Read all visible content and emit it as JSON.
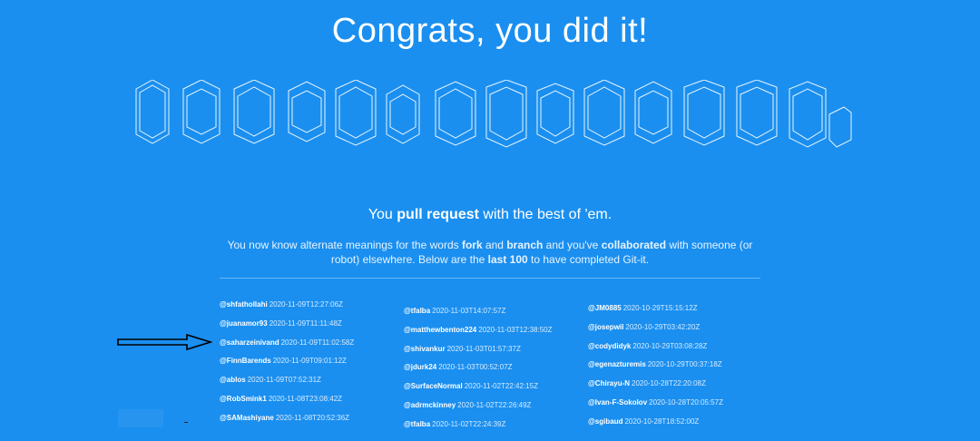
{
  "title": "Congrats, you did it!",
  "subtitle": {
    "part1": "You ",
    "strong1": "pull request",
    "part2": " with the best of 'em."
  },
  "intro": {
    "p1": "You now know alternate meanings for the words ",
    "b1": "fork",
    "p2": " and ",
    "b2": "branch",
    "p3": " and you've ",
    "b3": "collaborated",
    "p4": " with someone (or robot) elsewhere. Below are the ",
    "b4": "last 100",
    "p5": " to have completed Git-it."
  },
  "contributors": {
    "col1": [
      {
        "user": "@shfathollahi",
        "time": "2020-11-09T12:27:06Z"
      },
      {
        "user": "@juanamor93",
        "time": "2020-11-09T11:11:48Z"
      },
      {
        "user": "@saharzeinivand",
        "time": "2020-11-09T11:02:58Z"
      },
      {
        "user": "@FinnBarends",
        "time": "2020-11-09T09:01:12Z"
      },
      {
        "user": "@ablos",
        "time": "2020-11-09T07:52:31Z"
      },
      {
        "user": "@RobSmink1",
        "time": "2020-11-08T23:08:42Z"
      },
      {
        "user": "@SAMashiyane",
        "time": "2020-11-08T20:52:36Z"
      }
    ],
    "col2": [
      {
        "user": "@tfalba",
        "time": "2020-11-03T14:07:57Z"
      },
      {
        "user": "@matthewbenton224",
        "time": "2020-11-03T12:38:50Z"
      },
      {
        "user": "@shivankur",
        "time": "2020-11-03T01:57:37Z"
      },
      {
        "user": "@jdurk24",
        "time": "2020-11-03T00:52:07Z"
      },
      {
        "user": "@SurfaceNormal",
        "time": "2020-11-02T22:42:15Z"
      },
      {
        "user": "@adrmckinney",
        "time": "2020-11-02T22:26:49Z"
      },
      {
        "user": "@tfalba",
        "time": "2020-11-02T22:24:39Z"
      }
    ],
    "col3": [
      {
        "user": "@JM0885",
        "time": "2020-10-29T15:15:12Z"
      },
      {
        "user": "@josepwil",
        "time": "2020-10-29T03:42:20Z"
      },
      {
        "user": "@codydidyk",
        "time": "2020-10-29T03:08:28Z"
      },
      {
        "user": "@egenazturemis",
        "time": "2020-10-29T00:37:18Z"
      },
      {
        "user": "@Chirayu-N",
        "time": "2020-10-28T22:20:08Z"
      },
      {
        "user": "@Ivan-F-Sokolov",
        "time": "2020-10-28T20:05:57Z"
      },
      {
        "user": "@sgibaud",
        "time": "2020-10-28T18:52:00Z"
      }
    ]
  },
  "colors": {
    "background": "#1a8ff0",
    "text": "#ffffff",
    "banner_line": "#ffffff"
  },
  "icons": {
    "arrow": "arrow-right-icon"
  }
}
